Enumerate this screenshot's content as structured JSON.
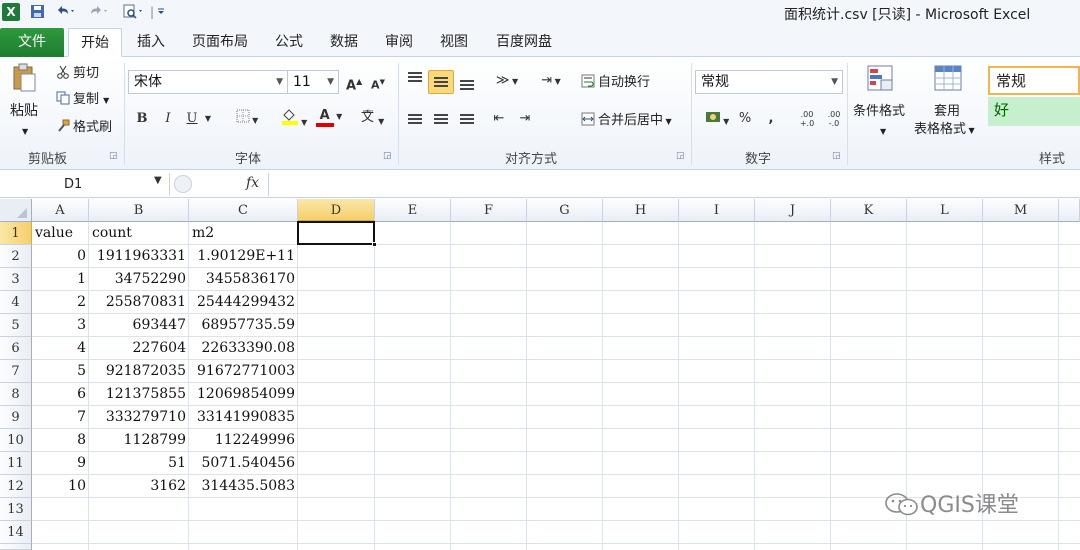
{
  "window": {
    "title": "面积统计.csv  [只读]  -  Microsoft Excel"
  },
  "qat": {
    "app_icon": "X",
    "save_icon": "save-icon",
    "undo_icon": "undo-icon",
    "redo_icon": "redo-icon",
    "preview_icon": "print-preview-icon"
  },
  "tabs": {
    "file": "文件",
    "items": [
      "开始",
      "插入",
      "页面布局",
      "公式",
      "数据",
      "审阅",
      "视图",
      "百度网盘"
    ],
    "active": "开始"
  },
  "ribbon": {
    "clipboard": {
      "paste": "粘贴",
      "cut": "剪切",
      "copy": "复制",
      "format_painter": "格式刷",
      "label": "剪贴板"
    },
    "font": {
      "name": "宋体",
      "size": "11",
      "grow": "A",
      "shrink": "A",
      "bold": "B",
      "italic": "I",
      "underline": "U",
      "font_color_letter": "A",
      "phonetic": "wén",
      "label": "字体"
    },
    "alignment": {
      "wrap_text": "自动换行",
      "merge_center": "合并后居中",
      "label": "对齐方式"
    },
    "number": {
      "format": "常规",
      "percent": "%",
      "comma": ",",
      "inc_decimal": ".00 +.0",
      "dec_decimal": ".00 -.0",
      "label": "数字"
    },
    "styles": {
      "conditional": "条件格式",
      "table_format_1": "套用",
      "table_format_2": "表格格式",
      "normal": "常规",
      "good": "好",
      "label": "样式"
    }
  },
  "formula_bar": {
    "name_box": "D1",
    "fx": "fx",
    "value": ""
  },
  "grid": {
    "columns": [
      "A",
      "B",
      "C",
      "D",
      "E",
      "F",
      "G",
      "H",
      "I",
      "J",
      "K",
      "L",
      "M"
    ],
    "selected_column": "D",
    "selected_row": "1",
    "row_numbers": [
      "1",
      "2",
      "3",
      "4",
      "5",
      "6",
      "7",
      "8",
      "9",
      "10",
      "11",
      "12",
      "13",
      "14"
    ],
    "header": {
      "a": "value",
      "b": "count",
      "c": "m2"
    },
    "rows": [
      {
        "a": "0",
        "b": "1911963331",
        "c": "1.90129E+11"
      },
      {
        "a": "1",
        "b": "34752290",
        "c": "3455836170"
      },
      {
        "a": "2",
        "b": "255870831",
        "c": "25444299432"
      },
      {
        "a": "3",
        "b": "693447",
        "c": "68957735.59"
      },
      {
        "a": "4",
        "b": "227604",
        "c": "22633390.08"
      },
      {
        "a": "5",
        "b": "921872035",
        "c": "91672771003"
      },
      {
        "a": "6",
        "b": "121375855",
        "c": "12069854099"
      },
      {
        "a": "7",
        "b": "333279710",
        "c": "33141990835"
      },
      {
        "a": "8",
        "b": "1128799",
        "c": "112249996"
      },
      {
        "a": "9",
        "b": "51",
        "c": "5071.540456"
      },
      {
        "a": "10",
        "b": "3162",
        "c": "314435.5083"
      }
    ]
  },
  "watermark": {
    "text": "QGIS课堂"
  },
  "colors": {
    "file_tab": "#1e7d2f",
    "selection": "#f6cf6a",
    "good_style_bg": "#c6efce",
    "good_style_fg": "#006100"
  }
}
